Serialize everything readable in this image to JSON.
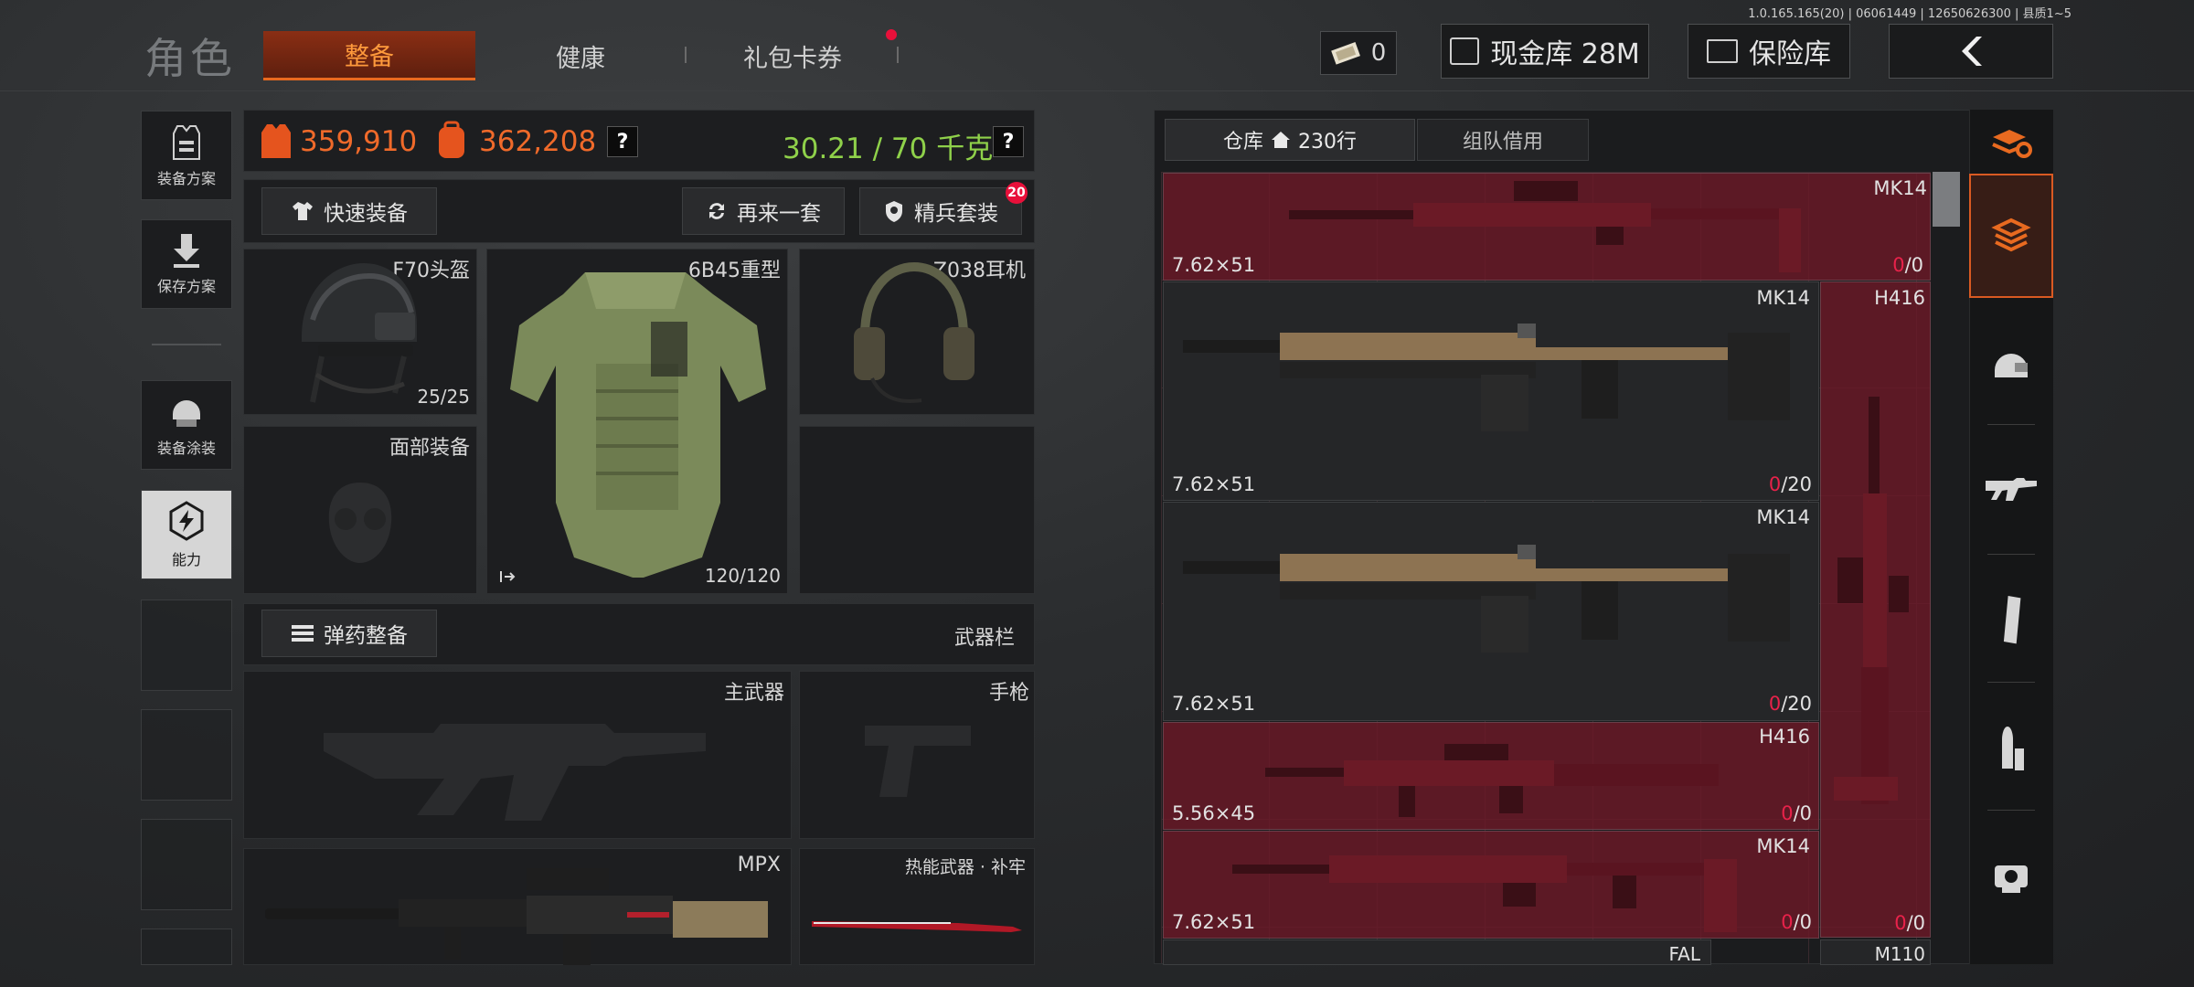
{
  "version": "1.0.165.165(20) | 06061449 | 12650626300 | 县质1~5",
  "header": {
    "title": "角色",
    "tabs": [
      {
        "label": "整备",
        "active": true
      },
      {
        "label": "健康",
        "active": false
      },
      {
        "label": "礼包卡券",
        "active": false,
        "badge_dot": true
      }
    ],
    "ticket_count": "0",
    "cash_button": "现金库 28M",
    "safe_button": "保险库",
    "back_icon": "chevron-left-icon"
  },
  "left_rail": {
    "items": [
      {
        "label": "装备方案",
        "icon": "vest-icon"
      },
      {
        "label": "保存方案",
        "icon": "download-icon"
      },
      {
        "label": "装备涂装",
        "icon": "helmet-paint-icon"
      },
      {
        "label": "能力",
        "icon": "ability-icon"
      }
    ]
  },
  "stats": {
    "vest_value": "359,910",
    "bag_value": "362,208",
    "weight": "30.21 / 70 千克",
    "help": "?"
  },
  "loadout": {
    "quick_equip": "快速装备",
    "again": "再来一套",
    "elite": "精兵套装",
    "elite_badge": "20"
  },
  "equipment": {
    "helmet": {
      "name": "F70头盔",
      "durability": "25/25"
    },
    "armor": {
      "name": "6B45重型",
      "durability": "120/120"
    },
    "headset": {
      "name": "Z038耳机"
    },
    "face": {
      "name": "面部装备"
    }
  },
  "weapons": {
    "ammo_button": "弹药整备",
    "bar_label": "武器栏",
    "primary": "主武器",
    "pistol": "手枪",
    "secondary": "MPX",
    "melee": "热能武器 · 补牢"
  },
  "inventory": {
    "tabs": [
      {
        "label": "仓库",
        "count": "230行",
        "active": true
      },
      {
        "label": "组队借用",
        "active": false
      }
    ],
    "items": [
      {
        "name": "MK14",
        "caliber": "7.62×51",
        "count_red": "0",
        "count_rest": "/0",
        "style": "red"
      },
      {
        "name": "MK14",
        "caliber": "7.62×51",
        "count_red": "0",
        "count_rest": "/20",
        "style": "grey"
      },
      {
        "name": "H416",
        "caliber": "",
        "count_red": "0",
        "count_rest": "/0",
        "style": "red"
      },
      {
        "name": "MK14",
        "caliber": "7.62×51",
        "count_red": "0",
        "count_rest": "/20",
        "style": "grey"
      },
      {
        "name": "H416",
        "caliber": "5.56×45",
        "count_red": "0",
        "count_rest": "/0",
        "style": "red"
      },
      {
        "name": "MK14",
        "caliber": "7.62×51",
        "count_red": "0",
        "count_rest": "/0",
        "style": "red"
      },
      {
        "name": "FAL",
        "style": "grey"
      },
      {
        "name": "M110",
        "style": "grey"
      }
    ]
  },
  "tool_rail": [
    "sort-refresh-icon",
    "stack-icon",
    "helmet-icon",
    "rifle-icon",
    "magazine-icon",
    "ammo-icon",
    "scope-icon"
  ],
  "colors": {
    "accent": "#e86a20",
    "red_item": "#6e1828",
    "count_red": "#e8224a",
    "green_weight": "#8fd14a"
  }
}
